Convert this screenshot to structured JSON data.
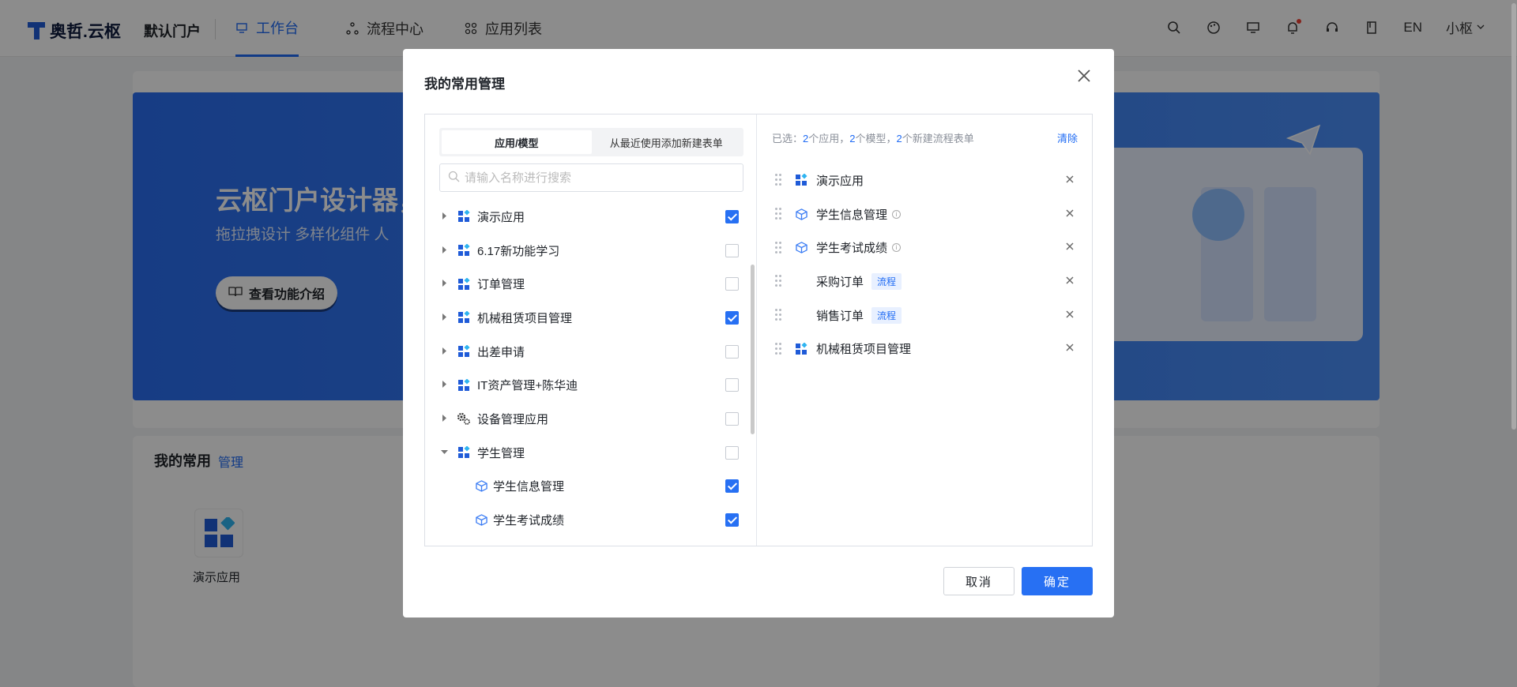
{
  "nav": {
    "logo_text": "奥哲.云枢",
    "portal": "默认门户",
    "tabs": [
      {
        "label": "工作台",
        "icon": "monitor-icon",
        "active": true
      },
      {
        "label": "流程中心",
        "icon": "flow-icon",
        "active": false
      },
      {
        "label": "应用列表",
        "icon": "grid-icon",
        "active": false
      }
    ],
    "lang": "EN",
    "user": "小枢"
  },
  "banner": {
    "title": "云枢门户设计器，",
    "subtitle": "拖拉拽设计   多样化组件   人",
    "button": "查看功能介绍"
  },
  "common": {
    "title": "我的常用",
    "manage": "管理",
    "tile_label": "演示应用"
  },
  "modal": {
    "title": "我的常用管理",
    "tabs": [
      "应用/模型",
      "从最近使用添加新建表单"
    ],
    "search_placeholder": "请输入名称进行搜索",
    "tree": [
      {
        "label": "演示应用",
        "type": "app",
        "checked": true,
        "expanded": false
      },
      {
        "label": "6.17新功能学习",
        "type": "app",
        "checked": false,
        "expanded": false
      },
      {
        "label": "订单管理",
        "type": "app",
        "checked": false,
        "expanded": false
      },
      {
        "label": "机械租赁项目管理",
        "type": "app",
        "checked": true,
        "expanded": false
      },
      {
        "label": "出差申请",
        "type": "app",
        "checked": false,
        "expanded": false
      },
      {
        "label": "IT资产管理+陈华迪",
        "type": "app",
        "checked": false,
        "expanded": false
      },
      {
        "label": "设备管理应用",
        "type": "gear",
        "checked": false,
        "expanded": false
      },
      {
        "label": "学生管理",
        "type": "app",
        "checked": false,
        "expanded": true
      },
      {
        "label": "学生信息管理",
        "type": "model",
        "checked": true,
        "child": true
      },
      {
        "label": "学生考试成绩",
        "type": "model",
        "checked": true,
        "child": true
      }
    ],
    "summary": {
      "prefix": "已选：",
      "apps_count": "2",
      "apps_text": "个应用，",
      "models_count": "2",
      "models_text": "个模型，",
      "forms_count": "2",
      "forms_text": "个新建流程表单"
    },
    "clear": "清除",
    "selected": [
      {
        "label": "演示应用",
        "type": "app",
        "info": false,
        "tag": ""
      },
      {
        "label": "学生信息管理",
        "type": "model",
        "info": true,
        "tag": ""
      },
      {
        "label": "学生考试成绩",
        "type": "model",
        "info": true,
        "tag": ""
      },
      {
        "label": "采购订单",
        "type": "none",
        "info": false,
        "tag": "流程"
      },
      {
        "label": "销售订单",
        "type": "none",
        "info": false,
        "tag": "流程"
      },
      {
        "label": "机械租赁项目管理",
        "type": "app",
        "info": false,
        "tag": ""
      }
    ],
    "cancel": "取消",
    "ok": "确定"
  },
  "colors": {
    "primary": "#2770f3",
    "banner": "#2a6ef0"
  }
}
